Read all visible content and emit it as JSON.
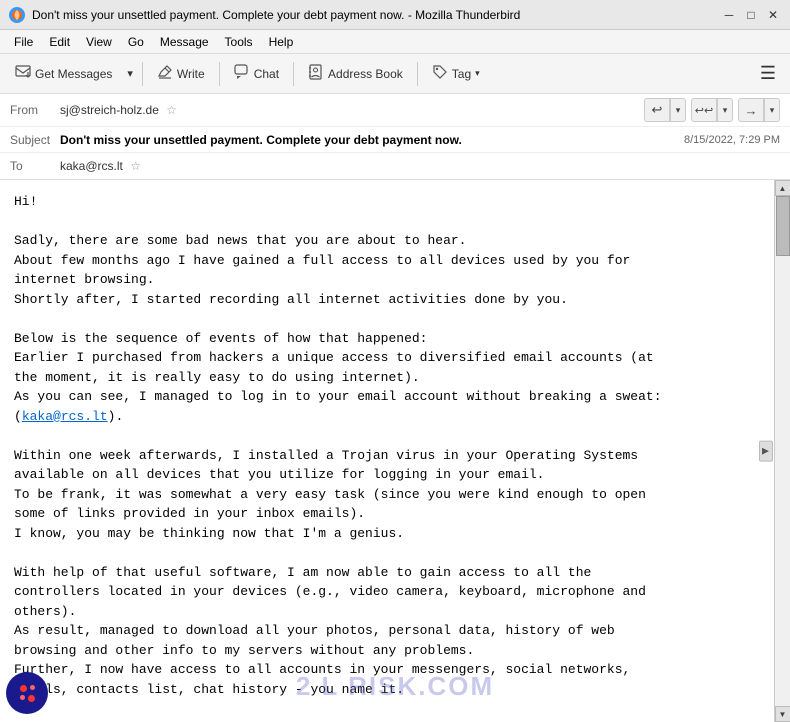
{
  "window": {
    "title": "Don't miss your unsettled payment. Complete your debt payment now. - Mozilla Thunderbird",
    "icon": "thunderbird"
  },
  "titlebar": {
    "minimize_label": "─",
    "maximize_label": "□",
    "close_label": "✕"
  },
  "menubar": {
    "items": [
      "File",
      "Edit",
      "View",
      "Go",
      "Message",
      "Tools",
      "Help"
    ]
  },
  "toolbar": {
    "get_messages_label": "Get Messages",
    "write_label": "Write",
    "chat_label": "Chat",
    "address_book_label": "Address Book",
    "tag_label": "Tag",
    "get_messages_icon": "↓",
    "write_icon": "✎",
    "chat_icon": "💬",
    "address_book_icon": "📋",
    "tag_icon": "🏷"
  },
  "email": {
    "from_label": "From",
    "from_value": "sj@streich-holz.de",
    "subject_label": "Subject",
    "subject_value": "Don't miss your unsettled payment. Complete your debt payment now.",
    "date_value": "8/15/2022, 7:29 PM",
    "to_label": "To",
    "to_value": "kaka@rcs.lt",
    "reply_icon": "↩",
    "reply_all_icon": "↩↩",
    "forward_down_icon": "▾",
    "forward_icon": "→",
    "more_icon": "▾",
    "body": "Hi!\n\nSadly, there are some bad news that you are about to hear.\nAbout few months ago I have gained a full access to all devices used by you for\ninternet browsing.\nShortly after, I started recording all internet activities done by you.\n\nBelow is the sequence of events of how that happened:\nEarlier I purchased from hackers a unique access to diversified email accounts (at\nthe moment, it is really easy to do using internet).\nAs you can see, I managed to log in to your email account without breaking a sweat:\n(kaka@rcs.lt).\n\nWithin one week afterwards, I installed a Trojan virus in your Operating Systems\navailable on all devices that you utilize for logging in your email.\nTo be frank, it was somewhat a very easy task (since you were kind enough to open\nsome of links provided in your inbox emails).\nI know, you may be thinking now that I'm a genius.\n\nWith help of that useful software, I am now able to gain access to all the\ncontrollers located in your devices (e.g., video camera, keyboard, microphone and\nothers).\nAs result, managed to download all your photos, personal data, history of web\nbrowsing and other info to my servers without any problems.\nFurther, I now have access to all accounts in your messengers, social networks,\nemails, contacts list, chat history - you name it.",
    "link_text": "kaka@rcs.lt"
  },
  "watermark": {
    "text": "2 L RISK.COM"
  }
}
